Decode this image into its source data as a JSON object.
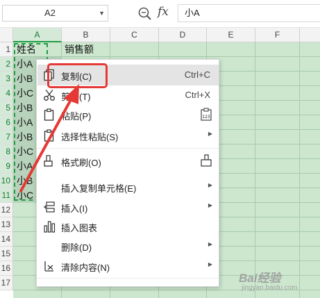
{
  "formula_bar": {
    "name_box": "A2",
    "fx_label": "fx",
    "formula_value": "小A"
  },
  "columns": [
    "A",
    "B",
    "C",
    "D",
    "E",
    "F"
  ],
  "rows": [
    "1",
    "2",
    "3",
    "4",
    "5",
    "6",
    "7",
    "8",
    "9",
    "10",
    "11",
    "12",
    "13",
    "14",
    "15",
    "16",
    "17"
  ],
  "cells": {
    "A1": "姓名",
    "B1": "销售额",
    "colA": [
      "小A",
      "小B",
      "小C",
      "小B",
      "小A",
      "小B",
      "小C",
      "小A",
      "小B",
      "小C"
    ]
  },
  "menu": {
    "copy": "复制(C)",
    "copy_shortcut": "Ctrl+C",
    "cut": "剪切(T)",
    "cut_shortcut": "Ctrl+X",
    "paste": "粘贴(P)",
    "paste_special": "选择性粘贴(S)",
    "format_painter": "格式刷(O)",
    "insert_copied": "插入复制单元格(E)",
    "insert": "插入(I)",
    "insert_chart": "插入图表",
    "delete": "删除(D)",
    "clear": "清除内容(N)"
  },
  "watermark": {
    "brand": "Bai经验",
    "url": "jingyan.baidu.com"
  },
  "colors": {
    "grid_green": "#cde7cf",
    "selection": "#1f9d43",
    "annotation_red": "#e53935"
  }
}
